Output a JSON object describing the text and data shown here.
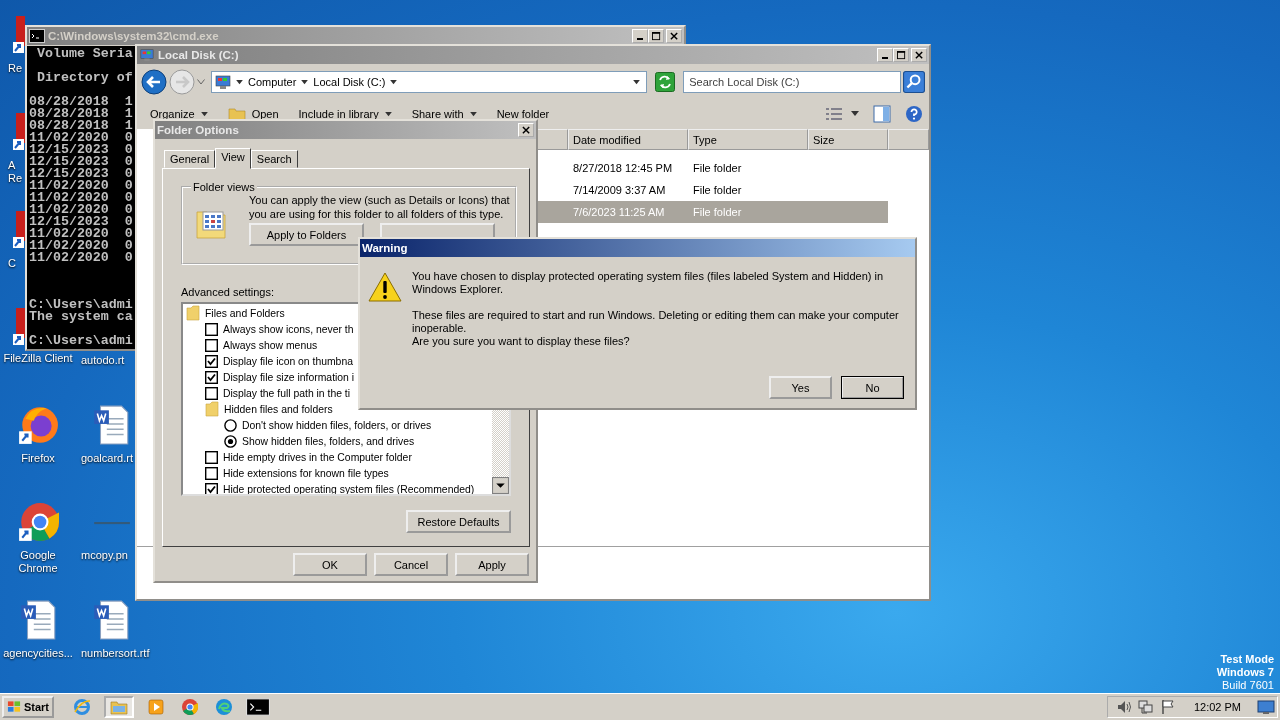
{
  "desktop": {
    "icons_column_1": [
      {
        "label": "Re",
        "kind": "partial"
      },
      {
        "label": "A\nRe",
        "kind": "partial"
      },
      {
        "label": "C",
        "kind": "partial"
      },
      {
        "label": "FileZilla Client",
        "kind": "filezilla"
      },
      {
        "label": "Firefox",
        "kind": "firefox"
      },
      {
        "label": "Google Chrome",
        "kind": "chrome"
      },
      {
        "label": "agencycities...",
        "kind": "document"
      }
    ],
    "icons_column_2": [
      {
        "label": "autodo.rt",
        "kind": "covered"
      },
      {
        "label": "goalcard.rt",
        "kind": "document"
      },
      {
        "label": "mcopy.pn",
        "kind": "image"
      },
      {
        "label": "numbersort.rtf",
        "kind": "document"
      }
    ],
    "system_notice": [
      "Test Mode",
      "Windows 7",
      "Build 7601"
    ]
  },
  "cmd": {
    "title": "C:\\Windows\\system32\\cmd.exe",
    "output_top": [
      [
        " Volume Seria"
      ],
      [
        " Directory of"
      ],
      [
        "08/28/2018  1",
        "08/28/2018  1",
        "08/28/2018  1",
        "11/02/2020  0",
        "12/15/2023  0",
        "12/15/2023  0",
        "12/15/2023  0",
        "11/02/2020  0",
        "11/02/2020  0",
        "11/02/2020  0",
        "12/15/2023  0",
        "11/02/2020  0",
        "11/02/2020  0",
        "11/02/2020  0"
      ]
    ],
    "output_bottom": [
      [
        "C:\\Users\\admi",
        "The system ca"
      ],
      [
        "C:\\Users\\admi"
      ]
    ]
  },
  "explorer": {
    "title": "Local Disk (C:)",
    "breadcrumb": [
      "Computer",
      "Local Disk (C:)"
    ],
    "search": {
      "placeholder": "Search Local Disk (C:)"
    },
    "toolbar": [
      {
        "label": "Organize",
        "dropdown": true,
        "kind": "menu"
      },
      {
        "label": "Open",
        "dropdown": false,
        "kind": "folder"
      },
      {
        "label": "Include in library",
        "dropdown": true,
        "kind": "menu"
      },
      {
        "label": "Share with",
        "dropdown": true,
        "kind": "menu"
      },
      {
        "label": "New folder",
        "dropdown": false,
        "kind": "menu"
      }
    ],
    "columns": [
      "Date modified",
      "Type",
      "Size"
    ],
    "rows": [
      {
        "date": "8/27/2018 12:45 PM",
        "type": "File folder",
        "selected": false
      },
      {
        "date": "7/14/2009 3:37 AM",
        "type": "File folder",
        "selected": false
      },
      {
        "date": "7/6/2023 11:25 AM",
        "type": "File folder",
        "selected": true
      }
    ]
  },
  "folder_options": {
    "title": "Folder Options",
    "tabs": [
      {
        "label": "General",
        "selected": false
      },
      {
        "label": "View",
        "selected": true
      },
      {
        "label": "Search",
        "selected": false
      }
    ],
    "folder_views": {
      "legend": "Folder views",
      "text": "You can apply the view (such as Details or Icons) that you are using for this folder to all folders of this type.",
      "buttons": [
        "Apply to Folders"
      ]
    },
    "advanced_label": "Advanced settings:",
    "settings": [
      {
        "kind": "group",
        "label": "Files and Folders",
        "children": [
          {
            "kind": "checkbox",
            "label": "Always show icons, never th",
            "checked": false
          },
          {
            "kind": "checkbox",
            "label": "Always show menus",
            "checked": false
          },
          {
            "kind": "checkbox",
            "label": "Display file icon on thumbna",
            "checked": true
          },
          {
            "kind": "checkbox",
            "label": "Display file size information i",
            "checked": true
          },
          {
            "kind": "checkbox",
            "label": "Display the full path in the ti",
            "checked": false
          },
          {
            "kind": "group",
            "label": "Hidden files and folders",
            "children": [
              {
                "kind": "radio",
                "label": "Don't show hidden files, folders, or drives",
                "selected": false
              },
              {
                "kind": "radio",
                "label": "Show hidden files, folders, and drives",
                "selected": true
              }
            ]
          },
          {
            "kind": "checkbox",
            "label": "Hide empty drives in the Computer folder",
            "checked": false
          },
          {
            "kind": "checkbox",
            "label": "Hide extensions for known file types",
            "checked": false
          },
          {
            "kind": "checkbox",
            "label": "Hide protected operating system files (Recommended)",
            "checked": true
          }
        ]
      }
    ],
    "restore": "Restore Defaults",
    "buttons": [
      "OK",
      "Cancel",
      "Apply"
    ]
  },
  "warning": {
    "title": "Warning",
    "message": "You have chosen to display protected operating system files (files labeled System and Hidden) in Windows Explorer.",
    "details": "These files are required to start and run Windows. Deleting or editing them can make your computer inoperable.",
    "question": "Are you sure you want to display these files?",
    "buttons": [
      {
        "label": "Yes",
        "default": false
      },
      {
        "label": "No",
        "default": true
      }
    ]
  },
  "taskbar": {
    "start": "Start",
    "apps": [
      {
        "kind": "ie",
        "active": false
      },
      {
        "kind": "explorer",
        "active": true
      },
      {
        "kind": "media",
        "active": false
      },
      {
        "kind": "chrome",
        "active": false
      },
      {
        "kind": "edge",
        "active": false
      },
      {
        "kind": "cmd",
        "active": false
      }
    ],
    "clock": "12:02 PM"
  }
}
